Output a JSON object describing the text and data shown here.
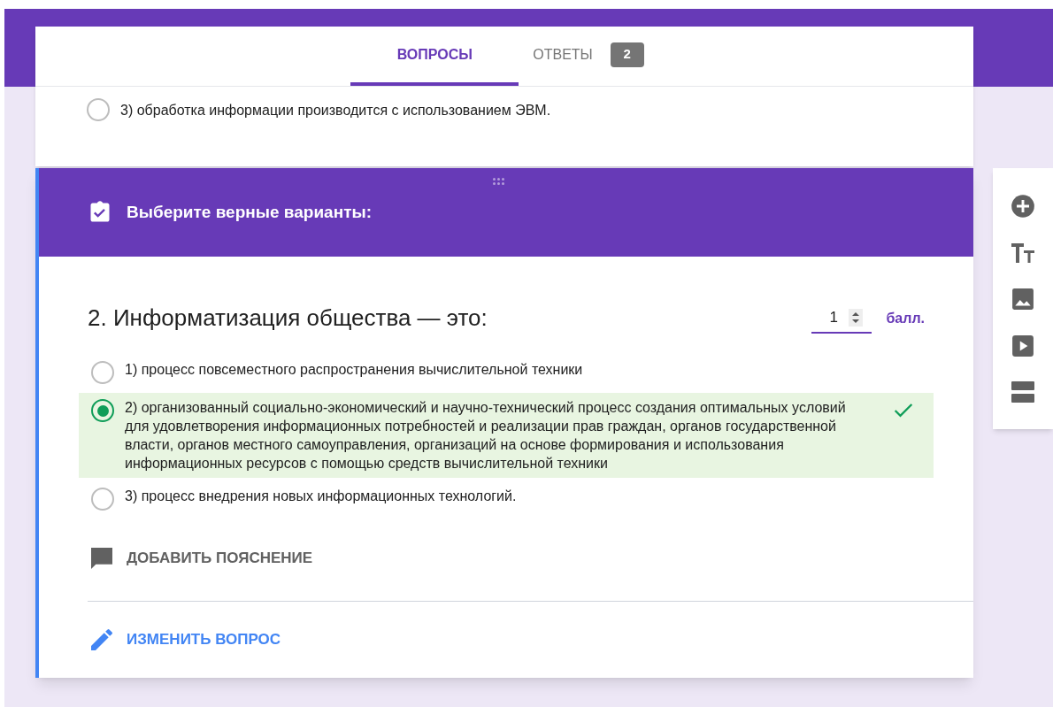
{
  "tabs": [
    {
      "label": "ВОПРОСЫ",
      "selected": true
    },
    {
      "label": "ОТВЕТЫ",
      "selected": false,
      "badge": "2"
    }
  ],
  "previous_option": {
    "label": "3) обработка информации производится с использованием ЭВМ.",
    "selected": false
  },
  "section": {
    "title": "Выберите верные варианты:"
  },
  "question": {
    "title": "2. Информатизация общества — это:",
    "points": "1",
    "points_unit": "балл.",
    "options": [
      {
        "label": "1) процесс повсеместного распространения вычислительной техники",
        "selected": false,
        "correct": false
      },
      {
        "label": "2) организованный социально-экономический и научно-технический процесс создания оптимальных условий для удовлетворения информационных потребностей и реализации прав граждан, органов государственной власти, органов местного самоуправления, организаций на основе формирования и использования информационных ресурсов с помощью средств вычислительной техники",
        "selected": true,
        "correct": true
      },
      {
        "label": "3) процесс внедрения новых информационных технологий.",
        "selected": false,
        "correct": false
      }
    ],
    "add_explanation": "ДОБАВИТЬ ПОЯСНЕНИЕ",
    "edit_question": "ИЗМЕНИТЬ ВОПРОС"
  }
}
